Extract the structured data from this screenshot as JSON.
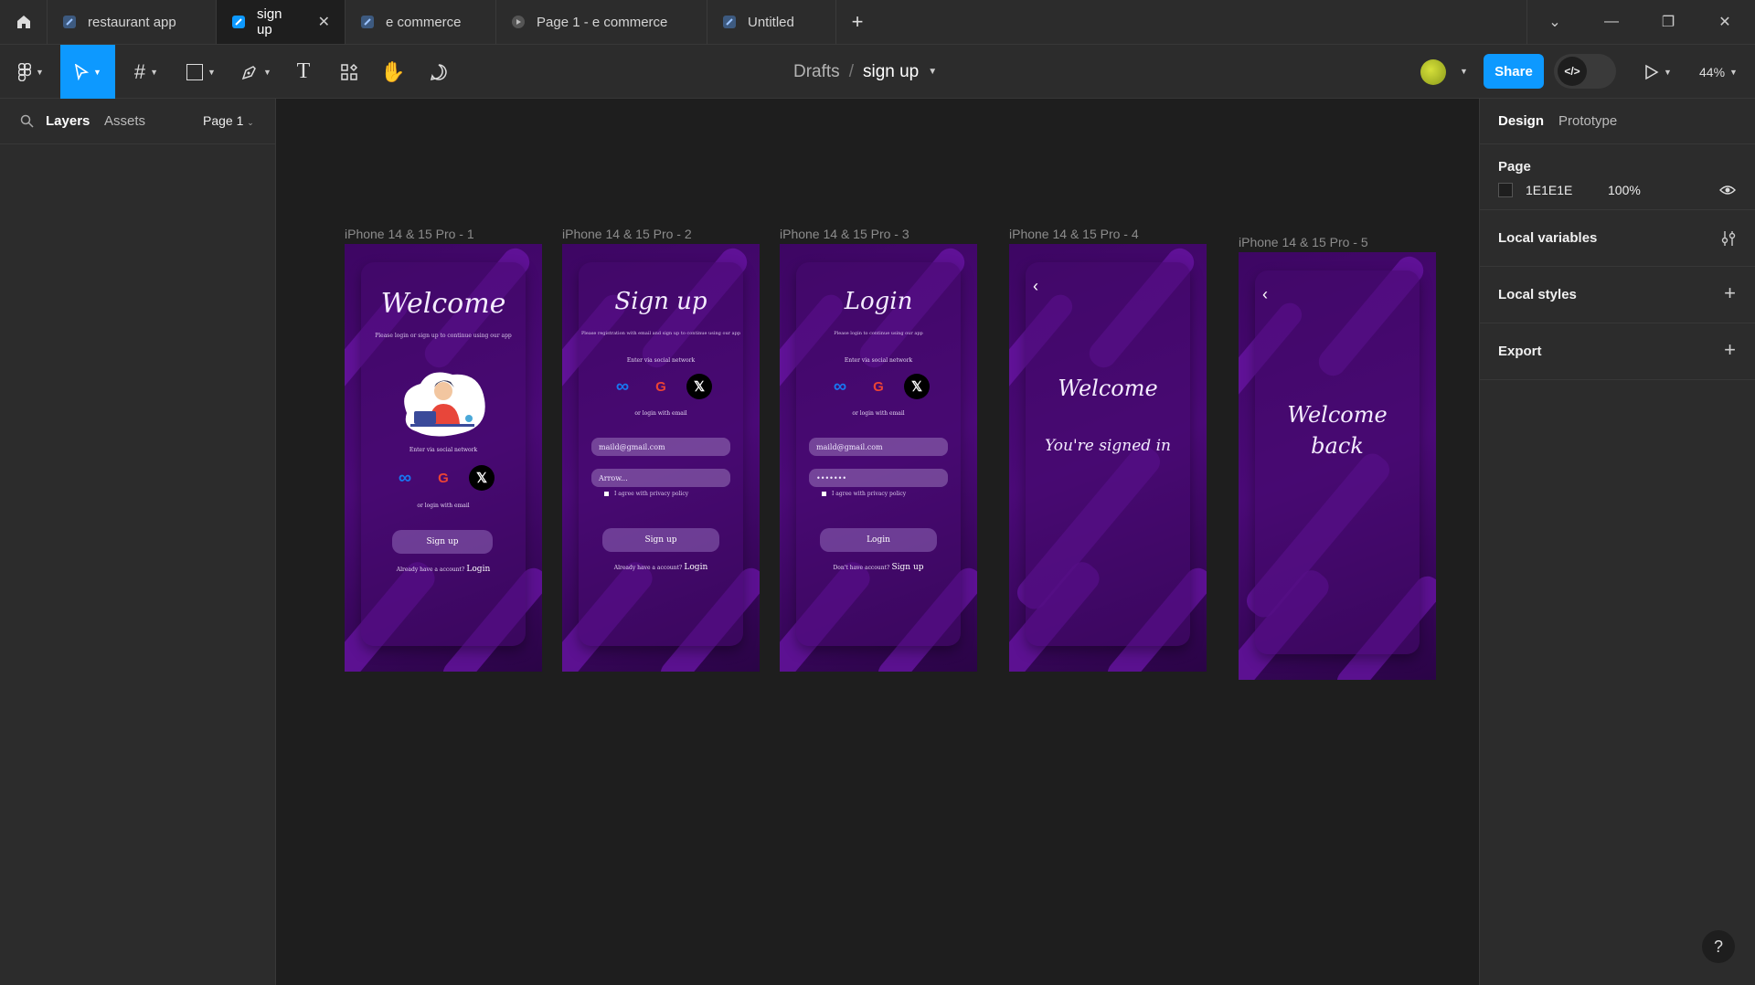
{
  "tabs": [
    {
      "label": "restaurant app",
      "icon": "figma-file-icon"
    },
    {
      "label": "sign up",
      "icon": "figma-file-icon",
      "active": true
    },
    {
      "label": "e commerce",
      "icon": "figma-file-icon"
    },
    {
      "label": "Page 1 - e commerce",
      "icon": "prototype-play-icon"
    },
    {
      "label": "Untitled",
      "icon": "figma-file-icon"
    }
  ],
  "breadcrumb": {
    "root": "Drafts",
    "separator": "/",
    "file": "sign up"
  },
  "toolbar": {
    "share_label": "Share",
    "zoom": "44%"
  },
  "left_panel": {
    "tab_layers": "Layers",
    "tab_assets": "Assets",
    "page_select": "Page 1"
  },
  "right_panel": {
    "tab_design": "Design",
    "tab_prototype": "Prototype",
    "page_section": "Page",
    "page_color": "1E1E1E",
    "page_opacity": "100%",
    "local_variables": "Local variables",
    "local_styles": "Local styles",
    "export": "Export"
  },
  "frames": {
    "f1": {
      "label": "iPhone 14 & 15 Pro - 1",
      "title": "Welcome",
      "subtitle": "Please login or sign up to continue using our app",
      "social_caption": "Enter via social network",
      "email_caption": "or login with email",
      "button": "Sign up",
      "footer": "Already have a account?",
      "footer_link": "Login"
    },
    "f2": {
      "label": "iPhone 14 & 15 Pro - 2",
      "title": "Sign up",
      "subtitle": "Please registration with email and sign up to continue using our app",
      "social_caption": "Enter via social network",
      "email_caption": "or login with email",
      "email_value": "maild@gmail.com",
      "password_value": "Arrow...",
      "checkbox": "I agree with privacy policy",
      "button": "Sign up",
      "footer": "Already have a account?",
      "footer_link": "Login"
    },
    "f3": {
      "label": "iPhone 14 & 15 Pro - 3",
      "title": "Login",
      "subtitle": "Please login to continue using our app",
      "social_caption": "Enter via social network",
      "email_caption": "or login with email",
      "email_value": "maild@gmail.com",
      "password_value": "•••••••",
      "checkbox": "I agree with privacy policy",
      "button": "Login",
      "footer": "Don't have account?",
      "footer_link": "Sign up"
    },
    "f4": {
      "label": "iPhone 14 & 15 Pro - 4",
      "title": "Welcome",
      "message": "You're signed in"
    },
    "f5": {
      "label": "iPhone 14 & 15 Pro - 5",
      "title": "Welcome",
      "title2": "back"
    }
  },
  "colors": {
    "accent": "#0d99ff",
    "frame_purple": "#4b0a78",
    "canvas": "#1e1e1e"
  }
}
